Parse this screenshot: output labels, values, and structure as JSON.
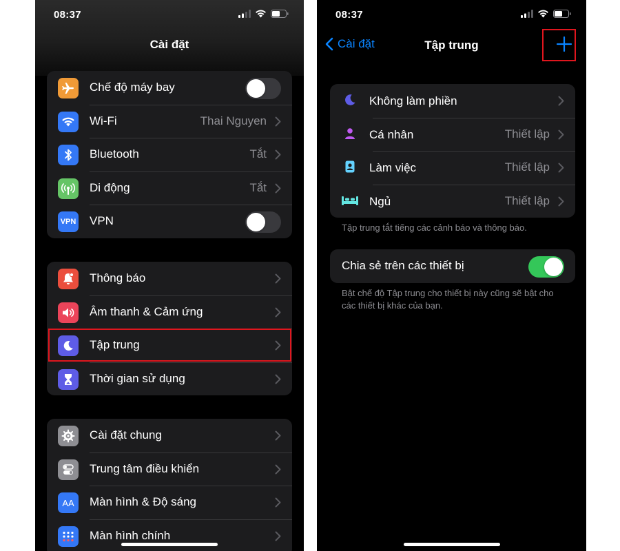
{
  "left_phone": {
    "status_time": "08:37",
    "nav_title": "Cài đặt",
    "groups": [
      {
        "items": [
          {
            "label": "Chế độ máy bay",
            "value": "",
            "control": "toggle",
            "toggle_on": false,
            "icon": "airplane-icon",
            "icon_color": "#f09a37"
          },
          {
            "label": "Wi-Fi",
            "value": "Thai Nguyen",
            "control": "chevron",
            "icon": "wifi-icon",
            "icon_color": "#3478f6"
          },
          {
            "label": "Bluetooth",
            "value": "Tắt",
            "control": "chevron",
            "icon": "bluetooth-icon",
            "icon_color": "#3478f6"
          },
          {
            "label": "Di động",
            "value": "Tắt",
            "control": "chevron",
            "icon": "cellular-icon",
            "icon_color": "#65c466"
          },
          {
            "label": "VPN",
            "value": "",
            "control": "toggle",
            "toggle_on": false,
            "icon": "vpn-icon",
            "icon_text": "VPN",
            "icon_color": "#3478f6"
          }
        ]
      },
      {
        "items": [
          {
            "label": "Thông báo",
            "control": "chevron",
            "icon": "bell-icon",
            "icon_color": "#eb4e3d"
          },
          {
            "label": "Âm thanh & Cảm ứng",
            "control": "chevron",
            "icon": "speaker-icon",
            "icon_color": "#eb445a"
          },
          {
            "label": "Tập trung",
            "control": "chevron",
            "icon": "moon-icon",
            "icon_color": "#5e5ce6",
            "highlighted": true
          },
          {
            "label": "Thời gian sử dụng",
            "control": "chevron",
            "icon": "hourglass-icon",
            "icon_color": "#5e5ce6"
          }
        ]
      },
      {
        "items": [
          {
            "label": "Cài đặt chung",
            "control": "chevron",
            "icon": "gear-icon",
            "icon_color": "#8e8e93"
          },
          {
            "label": "Trung tâm điều khiển",
            "control": "chevron",
            "icon": "switches-icon",
            "icon_color": "#8e8e93"
          },
          {
            "label": "Màn hình & Độ sáng",
            "control": "chevron",
            "icon": "text-size-icon",
            "icon_text": "AA",
            "icon_color": "#3478f6"
          },
          {
            "label": "Màn hình chính",
            "control": "chevron",
            "icon": "home-grid-icon",
            "icon_color": "#3478f6"
          }
        ]
      }
    ]
  },
  "right_phone": {
    "status_time": "08:37",
    "back_label": "Cài đặt",
    "nav_title": "Tập trung",
    "focus_items": [
      {
        "label": "Không làm phiền",
        "value": "",
        "icon": "moon-icon",
        "icon_color": "#5e5ce6"
      },
      {
        "label": "Cá nhân",
        "value": "Thiết lập",
        "icon": "person-icon",
        "icon_color": "#bf5af2"
      },
      {
        "label": "Làm việc",
        "value": "Thiết lập",
        "icon": "badge-icon",
        "icon_color": "#64d2ff"
      },
      {
        "label": "Ngủ",
        "value": "Thiết lập",
        "icon": "bed-icon",
        "icon_color": "#63e6e2"
      }
    ],
    "focus_footer": "Tập trung tắt tiếng các cảnh báo và thông báo.",
    "share_label": "Chia sẻ trên các thiết bị",
    "share_on": true,
    "share_footer": "Bật chế độ Tập trung cho thiết bị này cũng sẽ bật cho các thiết bị khác của bạn."
  },
  "colors": {
    "accent": "#0a84ff",
    "highlight": "#e0161e",
    "toggle_on": "#34c759"
  }
}
